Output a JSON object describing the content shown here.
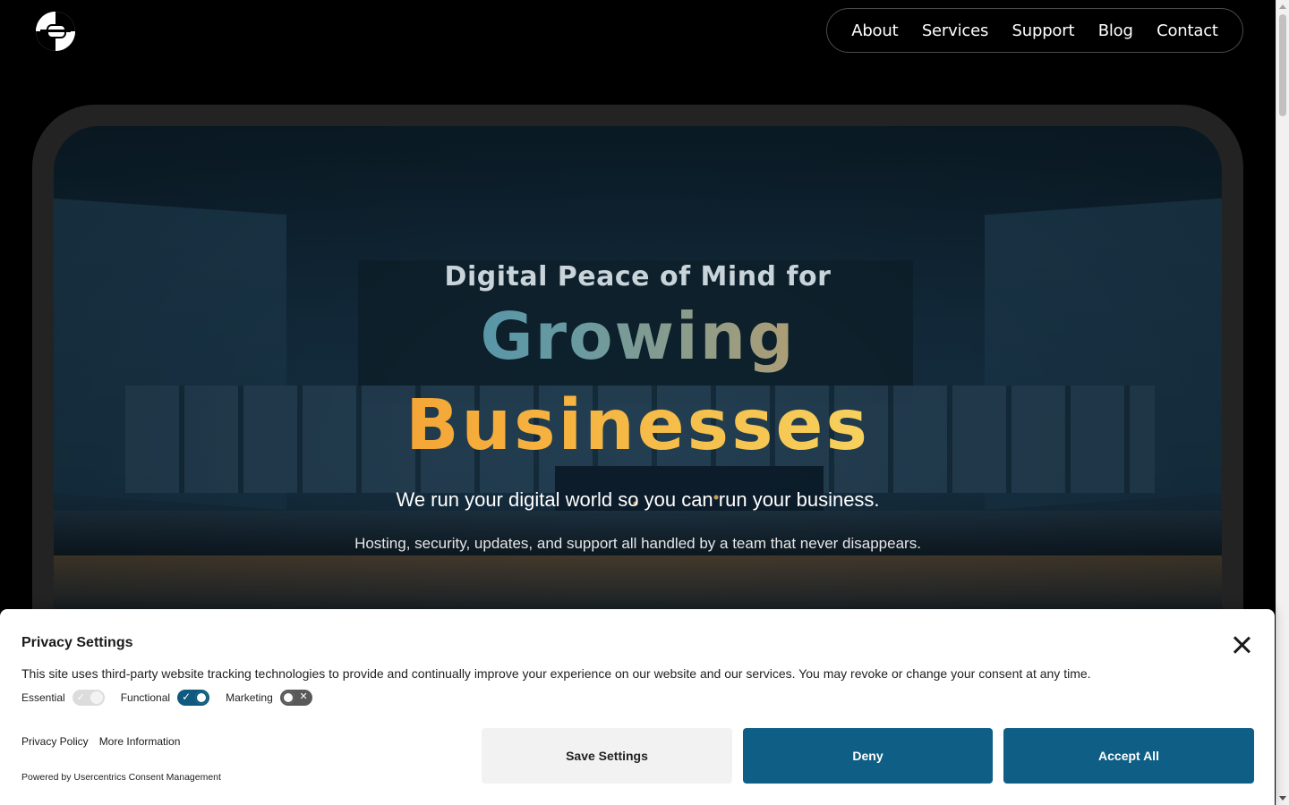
{
  "header": {
    "logo_icon": "logo-icon",
    "nav": [
      {
        "label": "About"
      },
      {
        "label": "Services"
      },
      {
        "label": "Support"
      },
      {
        "label": "Blog"
      },
      {
        "label": "Contact"
      }
    ]
  },
  "hero": {
    "eyebrow": "Digital Peace of Mind for",
    "headline_line1": "Growing",
    "headline_line2": "Businesses",
    "tagline": "We run your digital world so you can run your business.",
    "subtext": "Hosting, security, updates, and support all handled by a team that never disappears.",
    "gradient_line1": [
      "#0b86c7",
      "#6a9aa0",
      "#d8a05a",
      "#f59531"
    ],
    "gradient_line2": [
      "#f08a22",
      "#f6b441",
      "#f7dd6a",
      "#eef59a"
    ]
  },
  "consent": {
    "title": "Privacy Settings",
    "description": "This site uses third-party website tracking technologies to provide and continually improve your experience on our website and our services. You may revoke or change your consent at any time.",
    "toggles": [
      {
        "label": "Essential",
        "state": "on-disabled"
      },
      {
        "label": "Functional",
        "state": "on"
      },
      {
        "label": "Marketing",
        "state": "off"
      }
    ],
    "links": {
      "privacy_policy": "Privacy Policy",
      "more_info": "More Information"
    },
    "powered_by": "Powered by Usercentrics Consent Management",
    "buttons": {
      "save": "Save Settings",
      "deny": "Deny",
      "accept": "Accept All"
    },
    "accent_color": "#0e5e85"
  }
}
